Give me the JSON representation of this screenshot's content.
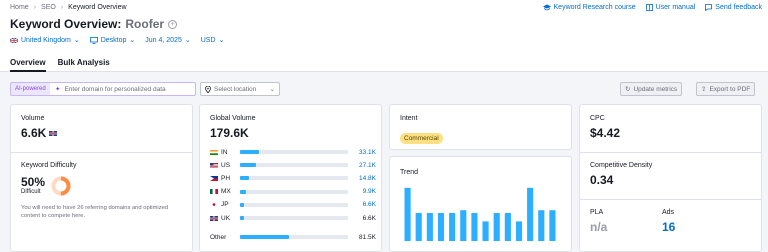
{
  "breadcrumb": [
    "Home",
    "SEO",
    "Keyword Overview"
  ],
  "top_links": [
    "Keyword Research course",
    "User manual",
    "Send feedback"
  ],
  "title": {
    "prefix": "Keyword Overview:",
    "keyword": "Roofer"
  },
  "filters": [
    "United Kingdom",
    "Desktop",
    "Jun 4, 2025",
    "USD"
  ],
  "tabs": [
    "Overview",
    "Bulk Analysis"
  ],
  "toolbar": {
    "ai_badge": "AI-powered",
    "domain_placeholder": "Enter domain for personalized data",
    "location_placeholder": "Select location",
    "update_label": "Update metrics",
    "export_label": "Export to PDF"
  },
  "volume": {
    "label": "Volume",
    "value": "6.6K"
  },
  "difficulty": {
    "label": "Keyword Difficulty",
    "value": "50%",
    "level": "Difficult",
    "percent": 50,
    "note": "You will need to have 26 referring domains and optimized content to compete here."
  },
  "global_volume": {
    "label": "Global Volume",
    "value": "179.6K",
    "rows": [
      {
        "code": "IN",
        "value": "33.1K",
        "fraction": 0.18,
        "link": true
      },
      {
        "code": "US",
        "value": "27.1K",
        "fraction": 0.15,
        "link": true
      },
      {
        "code": "PH",
        "value": "14.8K",
        "fraction": 0.08,
        "link": true
      },
      {
        "code": "MX",
        "value": "9.9K",
        "fraction": 0.055,
        "link": true
      },
      {
        "code": "JP",
        "value": "6.6K",
        "fraction": 0.037,
        "link": true
      },
      {
        "code": "UK",
        "value": "6.6K",
        "fraction": 0.037,
        "link": false
      }
    ],
    "other": {
      "label": "Other",
      "value": "81.5K",
      "fraction": 0.45
    }
  },
  "intent": {
    "label": "Intent",
    "value": "Commercial"
  },
  "trend": {
    "label": "Trend",
    "values": [
      0.95,
      0.5,
      0.5,
      0.5,
      0.5,
      0.55,
      0.5,
      0.35,
      0.5,
      0.5,
      0.35,
      0.95,
      0.55,
      0.55
    ]
  },
  "cpc": {
    "label": "CPC",
    "value": "$4.42"
  },
  "competitive_density": {
    "label": "Competitive Density",
    "value": "0.34"
  },
  "pla": {
    "label": "PLA",
    "value": "n/a"
  },
  "ads": {
    "label": "Ads",
    "value": "16"
  },
  "colors": {
    "accent": "#006dca",
    "bar": "#2dafff",
    "difficulty": "#ff8c43",
    "ai": "#8649e1",
    "intent": "#fce081"
  }
}
